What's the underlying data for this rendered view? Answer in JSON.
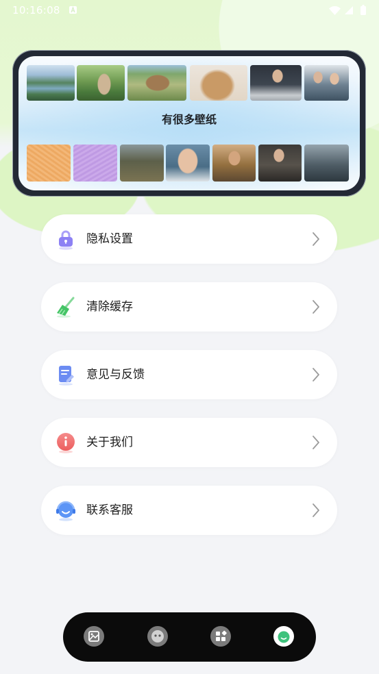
{
  "status_bar": {
    "time": "10:16:08",
    "icons": [
      "notification-icon",
      "wifi-icon",
      "signal-icon",
      "battery-icon"
    ]
  },
  "banner": {
    "title": "有很多壁纸"
  },
  "menu": {
    "items": [
      {
        "label": "隐私设置",
        "icon": "lock-icon"
      },
      {
        "label": "清除缓存",
        "icon": "broom-icon"
      },
      {
        "label": "意见与反馈",
        "icon": "feedback-icon"
      },
      {
        "label": "关于我们",
        "icon": "info-icon"
      },
      {
        "label": "联系客服",
        "icon": "customer-service-icon"
      }
    ]
  },
  "bottom_nav": {
    "items": [
      {
        "icon": "wallpaper-icon"
      },
      {
        "icon": "avatar-icon"
      },
      {
        "icon": "widgets-icon"
      },
      {
        "icon": "profile-icon"
      }
    ],
    "active_index": 3
  },
  "theme": {
    "background": "#f3f4f7",
    "accent_green": "#3ec27c",
    "nav_background": "#0b0b0b"
  }
}
